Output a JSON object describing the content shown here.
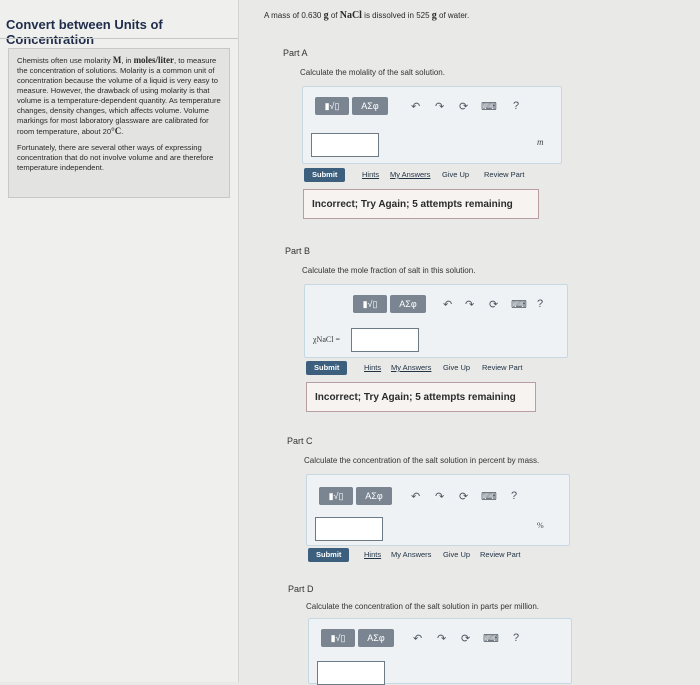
{
  "sidebar": {
    "title": "Convert between Units of Concentration",
    "intro_p1_pre": "Chemists often use molarity ",
    "intro_p1_sym": "M",
    "intro_p1_mid": ", in ",
    "intro_p1_unit": "moles/liter",
    "intro_p1_post": ", to measure the concentration of solutions. Molarity is a common unit of concentration because the volume of a liquid is very easy to measure. However, the drawback of using molarity is that volume is a temperature-dependent quantity. As temperature changes, density changes, which affects volume. Volume markings for most laboratory glassware are calibrated for room temperature, about 20",
    "intro_p1_deg": "°C",
    "intro_p1_end": ".",
    "intro_p2": "Fortunately, there are several other ways of expressing concentration that do not involve volume and are therefore temperature independent."
  },
  "problem": {
    "pre": "A mass of 0.630 ",
    "g1": "g",
    "mid1": " of ",
    "nacl": "NaCl",
    "mid2": " is dissolved in 525 ",
    "g2": "g",
    "post": " of water."
  },
  "toolbar": {
    "template_label": "▮√▯",
    "greek_label": "ΑΣφ",
    "undo_icon": "↶",
    "redo_icon": "↷",
    "reset_icon": "⟳",
    "keyboard_icon": "⌨",
    "help_icon": "?"
  },
  "actions": {
    "submit": "Submit",
    "hints": "Hints",
    "my_answers": "My Answers",
    "give_up": "Give Up",
    "review_part": "Review Part"
  },
  "parts": {
    "a": {
      "label": "Part A",
      "prompt": "Calculate the molality of the salt solution.",
      "unit": "m",
      "feedback": "Incorrect; Try Again; 5 attempts remaining"
    },
    "b": {
      "label": "Part B",
      "prompt": "Calculate the mole fraction of salt in this solution.",
      "xlabel": "χNaCl =",
      "feedback": "Incorrect; Try Again; 5 attempts remaining"
    },
    "c": {
      "label": "Part C",
      "prompt": "Calculate the concentration of the salt solution in percent by mass.",
      "unit": "%"
    },
    "d": {
      "label": "Part D",
      "prompt": "Calculate the concentration of the salt solution in parts per million."
    }
  }
}
